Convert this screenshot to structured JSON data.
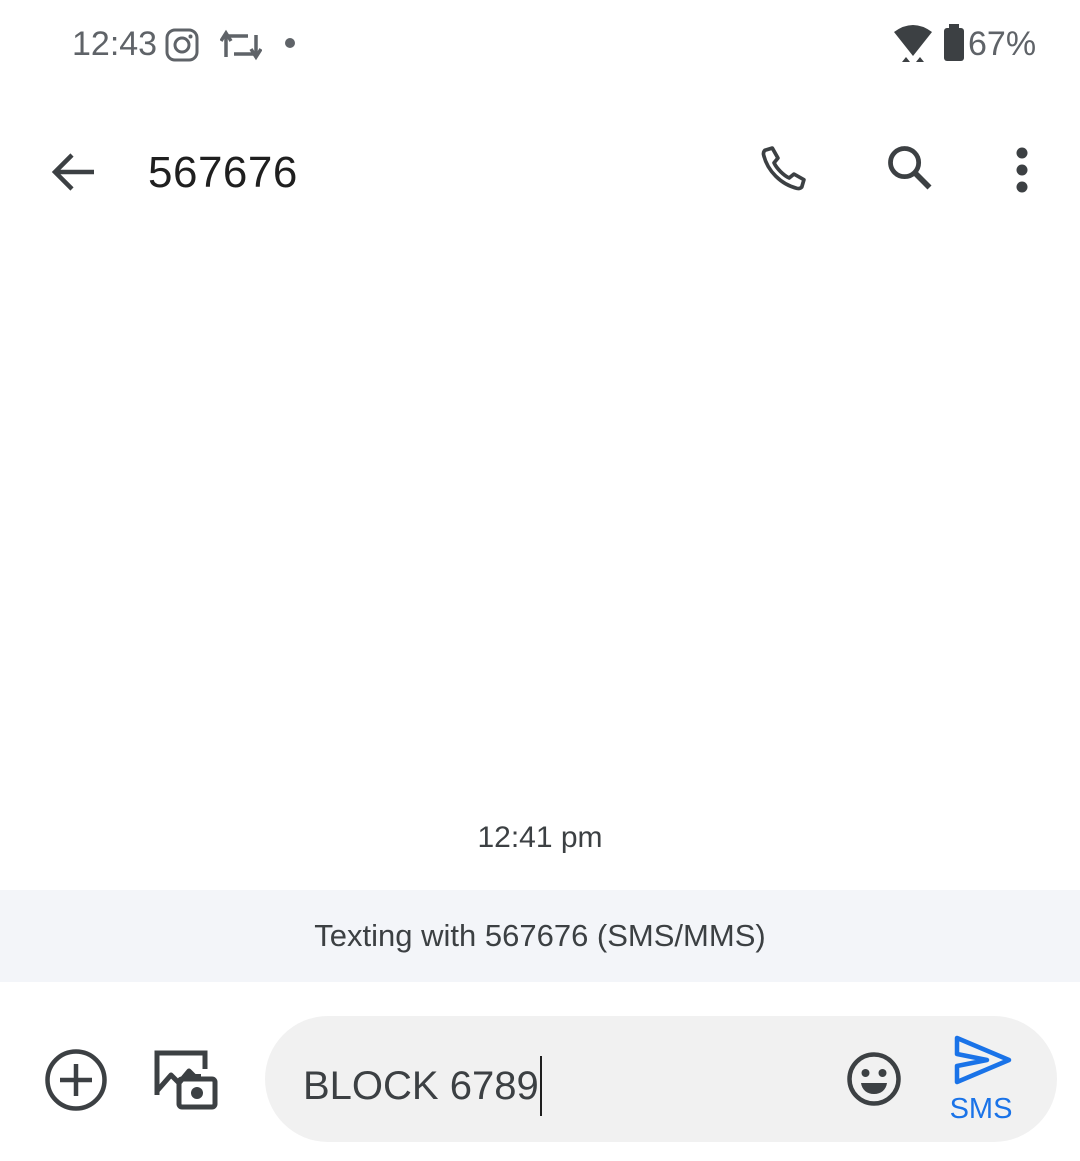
{
  "status_bar": {
    "time": "12:43",
    "battery_percent": "67%",
    "icons": [
      "instagram-icon",
      "repost-icon",
      "notification-dot-icon",
      "wifi-icon",
      "battery-icon"
    ]
  },
  "toolbar": {
    "title": "567676",
    "actions": [
      "back-arrow-icon",
      "phone-icon",
      "search-icon",
      "more-vert-icon"
    ]
  },
  "conversation": {
    "timestamp": "12:41 pm",
    "info_banner": "Texting with 567676 (SMS/MMS)"
  },
  "compose": {
    "input_value": "BLOCK 6789",
    "send_label": "SMS",
    "colors": {
      "accent": "#1a73e8",
      "field_background": "#f1f1f1",
      "banner_background": "#f3f5f9"
    }
  }
}
